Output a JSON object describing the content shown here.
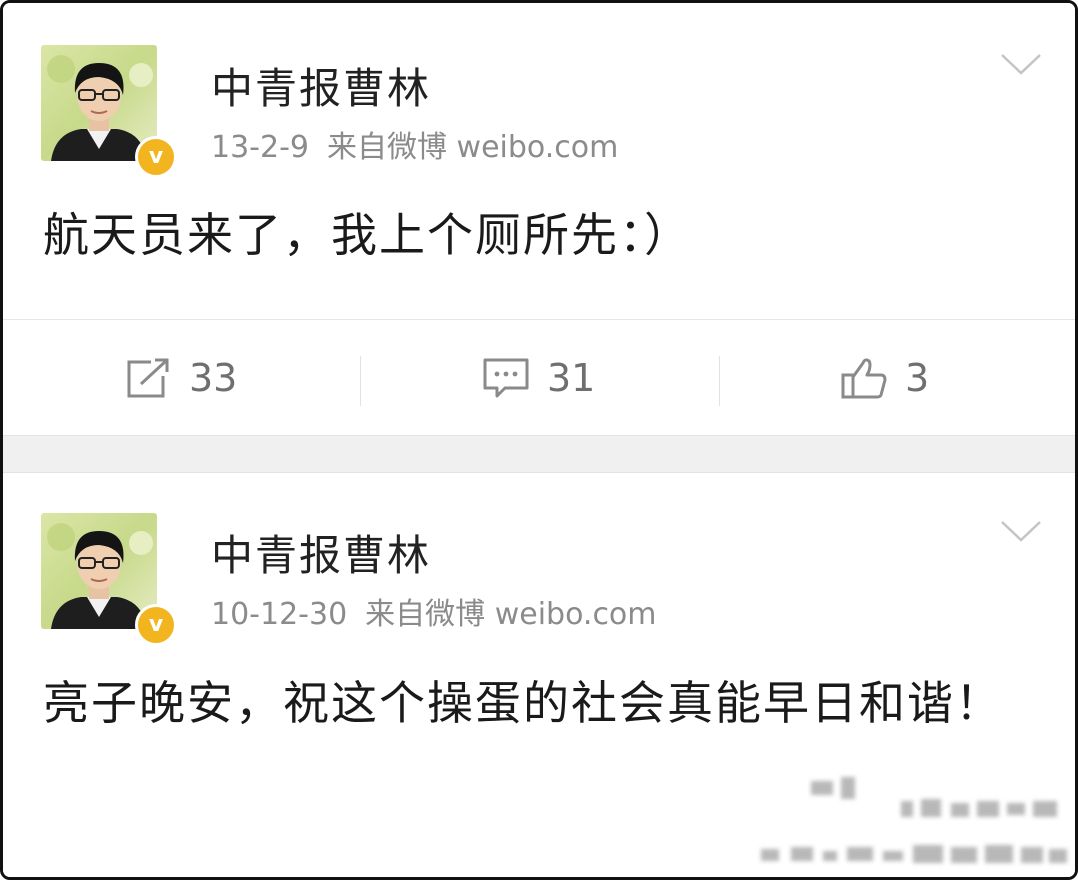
{
  "posts": [
    {
      "author": "中青报曹林",
      "date": "13-2-9",
      "source": "来自微博 weibo.com",
      "text": "航天员来了，我上个厕所先：）",
      "repost_count": "33",
      "comment_count": "31",
      "like_count": "3"
    },
    {
      "author": "中青报曹林",
      "date": "10-12-30",
      "source": "来自微博 weibo.com",
      "text": "亮子晚安，祝这个操蛋的社会真能早日和谐！"
    }
  ],
  "icons": {
    "verified": "verified-badge-icon",
    "menu": "chevron-down-icon",
    "repost": "repost-icon",
    "comment": "comment-icon",
    "like": "thumbs-up-icon"
  },
  "colors": {
    "verified_badge": "#f3b51f",
    "meta_text": "#8b8b8b",
    "separator": "#f0f0f0"
  },
  "verified_badge_letter": "v"
}
